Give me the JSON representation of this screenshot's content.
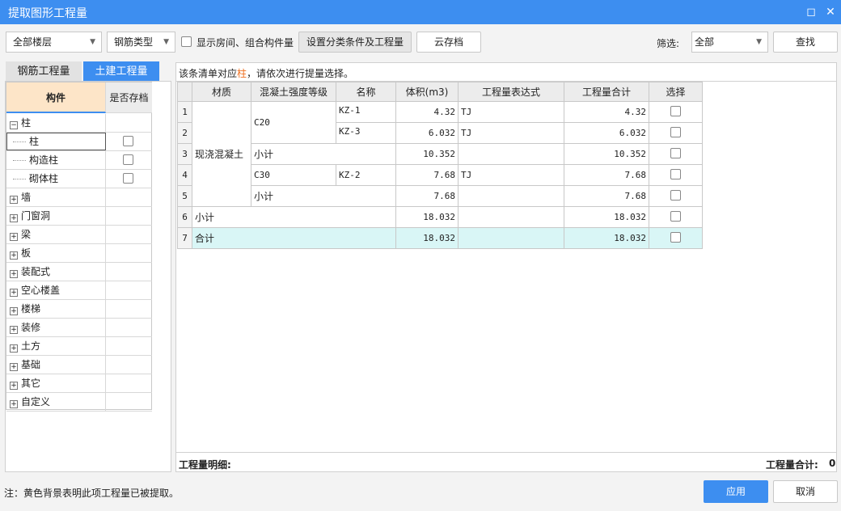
{
  "window": {
    "title": "提取图形工程量",
    "restore_icon": "restore-icon",
    "close_icon": "close-icon"
  },
  "toolbar": {
    "floor": "全部楼层",
    "rebar_type": "钢筋类型",
    "show_rooms_label": "显示房间、组合构件量",
    "show_rooms_checked": false,
    "set_conditions": "设置分类条件及工程量",
    "cloud_archive": "云存档",
    "filter_label": "筛选:",
    "filter_value": "全部",
    "find": "查找"
  },
  "tabs": [
    {
      "label": "钢筋工程量",
      "active": false
    },
    {
      "label": "土建工程量",
      "active": true
    }
  ],
  "tree": {
    "headers": [
      "构件",
      "是否存档"
    ],
    "items": [
      {
        "label": "柱",
        "expanded": true,
        "children": [
          {
            "label": "柱",
            "selected": true
          },
          {
            "label": "构造柱"
          },
          {
            "label": "砌体柱"
          }
        ]
      },
      {
        "label": "墙"
      },
      {
        "label": "门窗洞"
      },
      {
        "label": "梁"
      },
      {
        "label": "板"
      },
      {
        "label": "装配式"
      },
      {
        "label": "空心楼盖"
      },
      {
        "label": "楼梯"
      },
      {
        "label": "装修"
      },
      {
        "label": "土方"
      },
      {
        "label": "基础"
      },
      {
        "label": "其它"
      },
      {
        "label": "自定义"
      }
    ]
  },
  "hint": {
    "prefix": "该条清单对应",
    "highlight": "柱",
    "suffix": "，请依次进行提量选择。",
    "highlight_color": "#f07020"
  },
  "table": {
    "headers": [
      "",
      "材质",
      "混凝土强度等级",
      "名称",
      "体积(m3)",
      "工程量表达式",
      "工程量合计",
      "选择"
    ],
    "material": "现浇混凝土",
    "rows": [
      {
        "n": "1",
        "grade": "C20",
        "name": "KZ-1",
        "volume": "4.32",
        "expr": "TJ",
        "total": "4.32"
      },
      {
        "n": "2",
        "name": "KZ-3",
        "volume": "6.032",
        "expr": "TJ",
        "total": "6.032"
      },
      {
        "n": "3",
        "label": "小计",
        "volume": "10.352",
        "expr": "",
        "total": "10.352"
      },
      {
        "n": "4",
        "grade": "C30",
        "name": "KZ-2",
        "volume": "7.68",
        "expr": "TJ",
        "total": "7.68"
      },
      {
        "n": "5",
        "label": "小计",
        "volume": "7.68",
        "expr": "",
        "total": "7.68"
      },
      {
        "n": "6",
        "label": "小计",
        "volume": "18.032",
        "expr": "",
        "total": "18.032"
      },
      {
        "n": "7",
        "label": "合计",
        "volume": "18.032",
        "expr": "",
        "total": "18.032"
      }
    ]
  },
  "footer": {
    "detail_label": "工程量明细:",
    "sum_label": "工程量合计:",
    "sum_value": "0",
    "note": "注：黄色背景表明此项工程量已被提取。",
    "apply": "应用",
    "cancel": "取消"
  },
  "colors": {
    "accent": "#3d8ef0",
    "total_row": "#d9f6f6",
    "tree_header": "#fde5c8"
  }
}
